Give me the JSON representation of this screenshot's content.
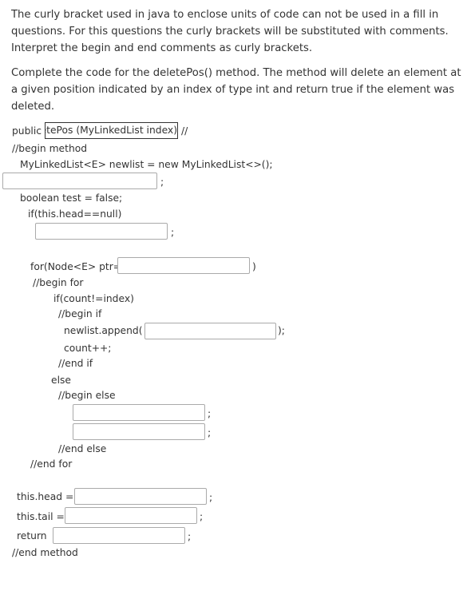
{
  "instructions": [
    "The curly bracket used in java to enclose units of code can not be used in a fill in questions. For this questions the curly brackets will be substituted with comments. Interpret the begin and end comments as curly brackets.",
    "Complete the code for the deletePos() method. The method will delete an element at a given position indicated by an index of type int and return true if the element was deleted."
  ],
  "code": {
    "public": "public",
    "signature_value": "etePos (MyLinkedList index)",
    "after_sig": "//",
    "begin_method": "//begin method",
    "newlist": "MyLinkedList<E> newlist = new MyLinkedList<>();",
    "semi": ";",
    "boolean": "boolean test = false;",
    "if_head": "if(this.head==null)",
    "for": "for(Node<E> ptr=",
    "close_paren": ")",
    "begin_for": "//begin for",
    "if_count": "if(count!=index)",
    "begin_if": "//begin if",
    "append": "newlist.append(",
    "append_close": ");",
    "count": "count++;",
    "end_if": "//end if",
    "else": "else",
    "begin_else": "//begin else",
    "end_else": "//end else",
    "end_for": "//end for",
    "head": "this.head =",
    "tail": "this.tail =",
    "return": "return",
    "end_method": "//end method"
  }
}
